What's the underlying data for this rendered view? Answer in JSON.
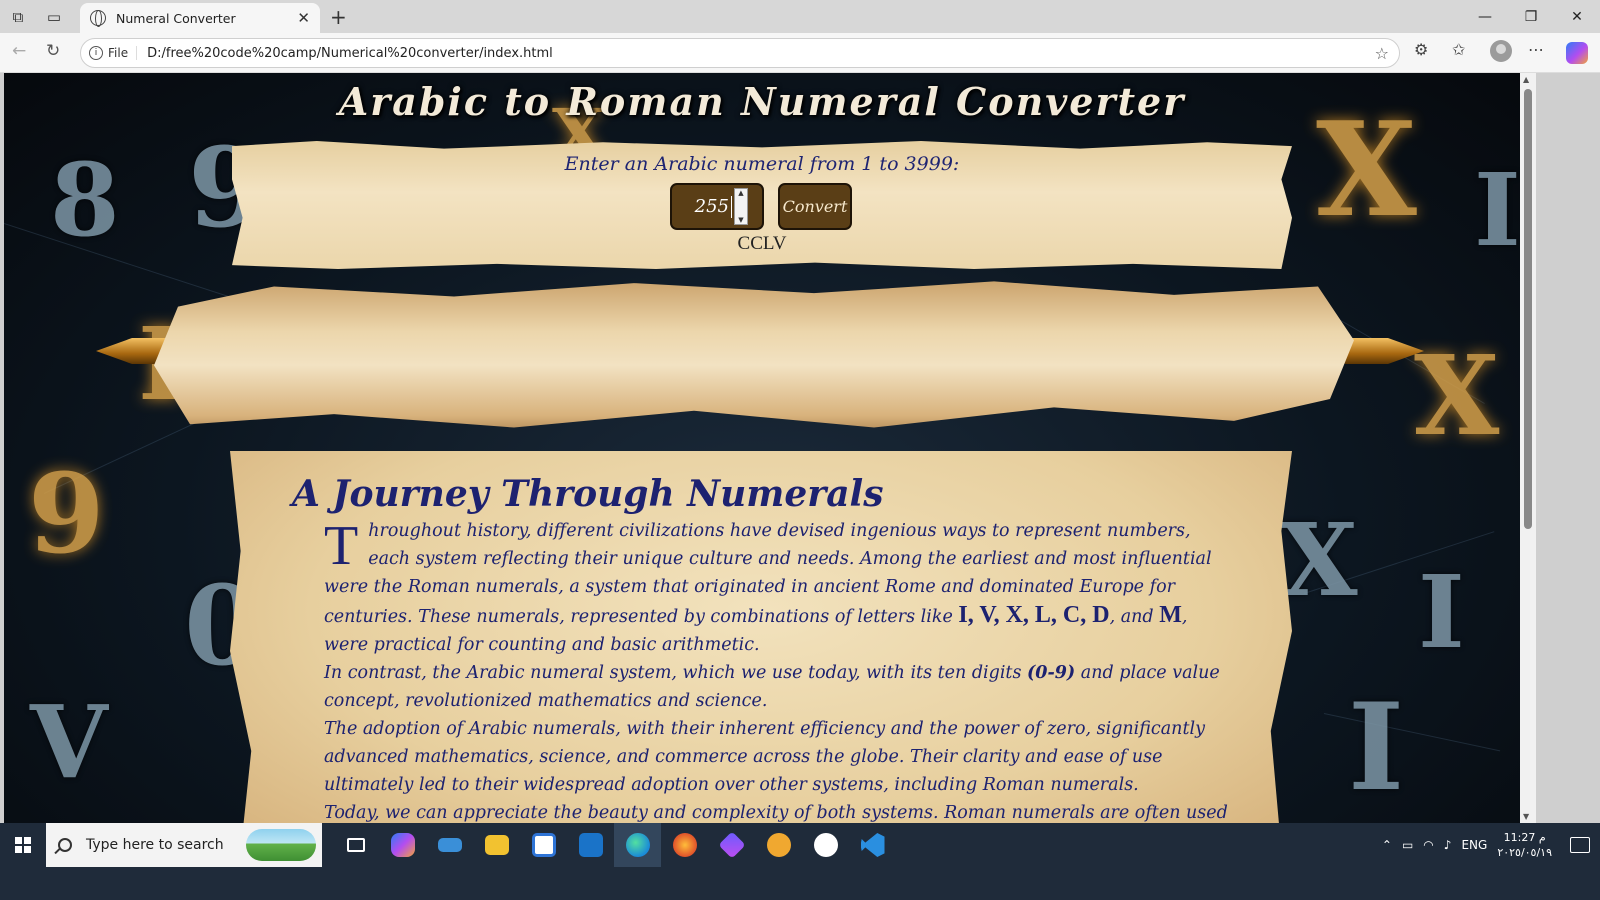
{
  "browser": {
    "tab_title": "Numeral Converter",
    "address_scheme": "File",
    "address_url": "D:/free%20code%20camp/Numerical%20converter/index.html"
  },
  "page": {
    "title": "Arabic to Roman Numeral Converter",
    "prompt": "Enter an Arabic numeral from 1 to 3999:",
    "input_value": "255",
    "convert_label": "Convert",
    "result": "CCLV",
    "article": {
      "heading": "A Journey Through Numerals",
      "dropcap": "T",
      "p1_a": "hroughout history, different civilizations have devised ingenious ways to represent numbers, each system reflecting their unique culture and needs. Among the earliest and most influential were the Roman numerals, a system that originated in ancient Rome and dominated Europe for centuries. These numerals, represented by combinations of letters like",
      "p1_letters": "I, V, X, L, C, D",
      "p1_and": ", and",
      "p1_m": "M",
      "p1_b": ", were practical for counting and basic arithmetic.",
      "p2_a": "In contrast, the Arabic numeral system, which we use today, with its ten digits",
      "p2_digits": "(0-9)",
      "p2_b": "and place value concept, revolutionized mathematics and science.",
      "p3": "The adoption of Arabic numerals, with their inherent efficiency and the power of zero, significantly advanced mathematics, science, and commerce across the globe. Their clarity and ease of use ultimately led to their widespread adoption over other systems, including Roman numerals.",
      "p4": "Today, we can appreciate the beauty and complexity of both systems. Roman numerals are often used in specific contexts, such as clock faces, book chapters, and movie titles, while Arabic numerals dominate everyday life, from simple calculations"
    },
    "background_digits": [
      "8",
      "9",
      "I",
      "9",
      "0",
      "V",
      "X",
      "X",
      "I",
      "X",
      "X",
      "I",
      "I",
      "X"
    ]
  },
  "taskbar": {
    "search_placeholder": "Type here to search",
    "language": "ENG",
    "time": "11:27 م",
    "date": "٢٠٢٥/٠٥/١٩"
  },
  "colors": {
    "title_ink": "#f3ead8",
    "article_ink": "#1d2270",
    "button_bg": "#5a3e16",
    "parchment": "#f0deb7",
    "taskbar_bg": "#1f2b3a"
  },
  "icons": [
    "workspaces-icon",
    "tab-actions-icon",
    "globe-icon",
    "close-icon",
    "new-tab-icon",
    "minimize-icon",
    "restore-icon",
    "window-close-icon",
    "back-icon",
    "refresh-icon",
    "info-icon",
    "star-icon",
    "extensions-icon",
    "favorites-icon",
    "profile-icon",
    "more-icon",
    "copilot-icon"
  ]
}
